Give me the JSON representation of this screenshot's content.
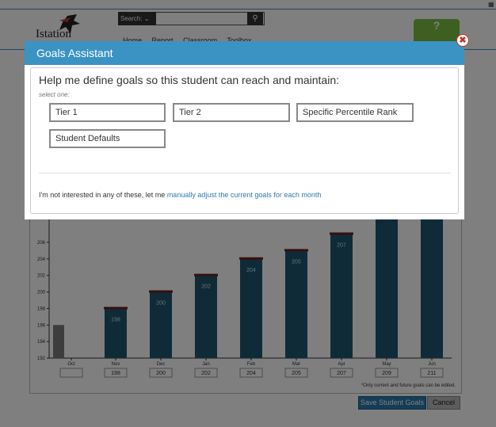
{
  "header": {
    "logo_text": "Istation",
    "search_label": "Search:",
    "nav": [
      "Home",
      "Report",
      "Classroom",
      "Toolbox"
    ],
    "help_label": "?"
  },
  "dialog": {
    "title": "Goals Assistant",
    "prompt": "Help me define goals so this student can reach and maintain:",
    "select_hint": "select one:",
    "options": [
      "Tier 1",
      "Tier 2",
      "Specific Percentile Rank",
      "Student Defaults"
    ],
    "footer_prefix": "I'm not interested in any of these, let me ",
    "footer_link": "manually adjust the current goals for each month",
    "close_label": "✖"
  },
  "chart_data": {
    "type": "bar",
    "categories": [
      "Oct",
      "Nov",
      "Dec",
      "Jan",
      "Feb",
      "Mar",
      "Apr",
      "May",
      "Jun"
    ],
    "values": [
      196,
      198,
      200,
      202,
      204,
      205,
      207,
      209,
      211
    ],
    "bar_labels": [
      "",
      "198",
      "200",
      "202",
      "204",
      "205",
      "207",
      "",
      ""
    ],
    "ylim": [
      192,
      208
    ],
    "yticks": [
      192,
      194,
      196,
      198,
      200,
      202,
      204,
      206
    ],
    "colors": {
      "past": "#7a7a7a",
      "goal": "#1f5670",
      "cap": "#6e1f1f"
    }
  },
  "goal_inputs": [
    "",
    "198",
    "200",
    "202",
    "204",
    "205",
    "207",
    "209",
    "211"
  ],
  "chart_note": "*Only current and future goals can be edited.",
  "buttons": {
    "save": "Save Student Goals",
    "cancel": "Cancel"
  }
}
